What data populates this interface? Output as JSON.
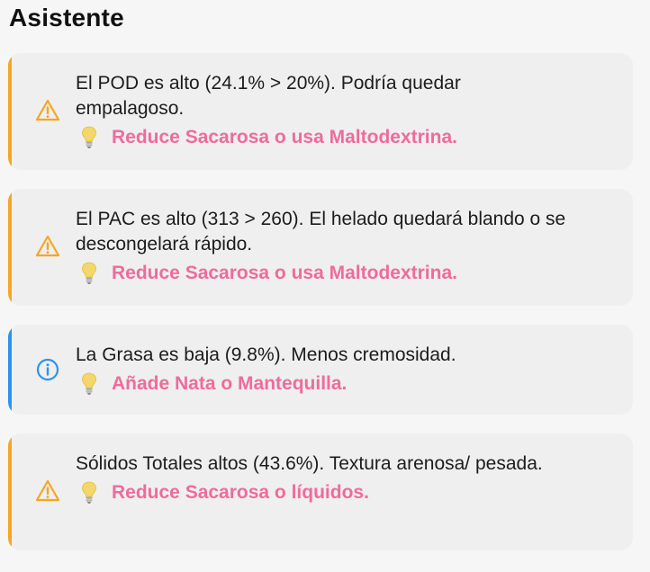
{
  "header": {
    "title": "Asistente"
  },
  "colors": {
    "warning": "#f5a623",
    "info": "#2b93f0",
    "suggestion": "#ef6b9c",
    "bulb": "#f4d76a"
  },
  "alerts": [
    {
      "type": "warning",
      "icon": "warning-triangle-icon",
      "message": "El POD es alto (24.1% > 20%). Podría quedar empalagoso.",
      "suggestion": "Reduce Sacarosa o usa Maltodextrina."
    },
    {
      "type": "warning",
      "icon": "warning-triangle-icon",
      "message": "El PAC es alto (313 > 260). El helado quedará blando o se descongelará rápido.",
      "suggestion": "Reduce Sacarosa o usa Maltodextrina."
    },
    {
      "type": "info",
      "icon": "info-circle-icon",
      "message": "La Grasa es baja (9.8%). Menos cremosidad.",
      "suggestion": "Añade Nata o Mantequilla."
    },
    {
      "type": "warning",
      "icon": "warning-triangle-icon",
      "message": "Sólidos Totales altos (43.6%). Textura arenosa/ pesada.",
      "suggestion": "Reduce Sacarosa o líquidos."
    }
  ]
}
